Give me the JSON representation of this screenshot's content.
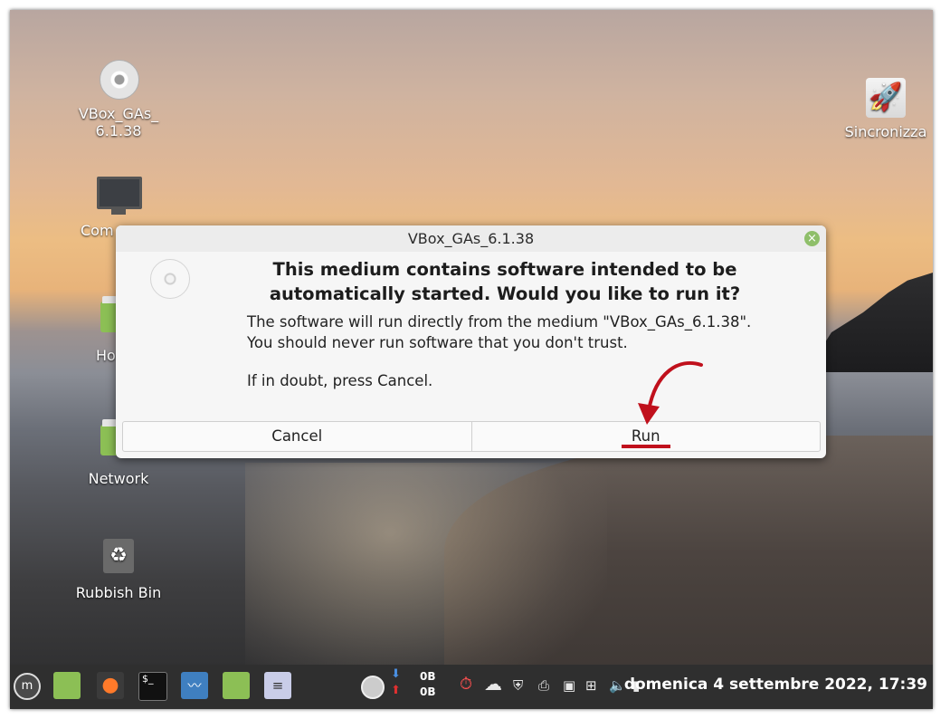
{
  "desktop": {
    "icons": [
      {
        "label": "VBox_GAs_\n6.1.38",
        "line1": "VBox_GAs_",
        "line2": "6.1.38"
      },
      {
        "label": "Com"
      },
      {
        "label": "Ho"
      },
      {
        "label": "Network"
      },
      {
        "label": "Rubbish Bin"
      },
      {
        "label": "Sincronizza"
      }
    ]
  },
  "dialog": {
    "title": "VBox_GAs_6.1.38",
    "heading_line1": "This medium contains software intended to be",
    "heading_line2": "automatically started. Would you like to run it?",
    "body_line1": "The software will run directly from the medium \"VBox_GAs_6.1.38\".",
    "body_line2": "You should never run software that you don't trust.",
    "body_line3": "If in doubt, press Cancel.",
    "cancel_label": "Cancel",
    "run_label": "Run",
    "close_glyph": "×"
  },
  "annotation": {
    "arrow_color": "#c0101c",
    "underline_color": "#c0101c"
  },
  "taskbar": {
    "net_down": "0B",
    "net_up": "0B",
    "clock": "domenica  4 settembre 2022, 17:39"
  },
  "colors": {
    "dialog_close": "#8fbf6a",
    "taskbar": "#2f2f2f"
  }
}
